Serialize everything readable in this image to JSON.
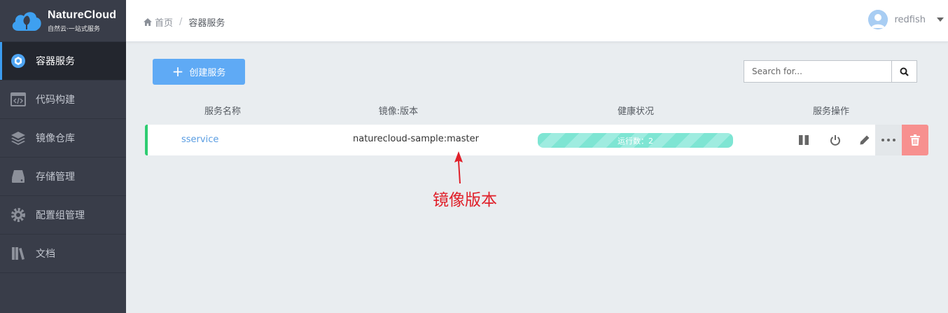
{
  "app": {
    "logo_title": "NatureCloud",
    "logo_subtitle": "自然云·一站式服务"
  },
  "sidebar": {
    "items": [
      {
        "label": "容器服务",
        "icon": "container-icon",
        "active": true
      },
      {
        "label": "代码构建",
        "icon": "code-icon"
      },
      {
        "label": "镜像仓库",
        "icon": "layers-icon"
      },
      {
        "label": "存储管理",
        "icon": "storage-icon"
      },
      {
        "label": "配置组管理",
        "icon": "gear-icon"
      },
      {
        "label": "文档",
        "icon": "books-icon"
      }
    ]
  },
  "header": {
    "breadcrumb": {
      "home": "首页",
      "separator": "/",
      "current": "容器服务"
    },
    "user": {
      "name": "redfish"
    }
  },
  "toolbar": {
    "create_label": "创建服务",
    "search_placeholder": "Search for..."
  },
  "table": {
    "headers": [
      "服务名称",
      "镜像:版本",
      "健康状况",
      "服务操作"
    ],
    "rows": [
      {
        "name": "sservice",
        "image": "naturecloud-sample:master",
        "health": "运行数：2",
        "status_color": "#2ecc71"
      }
    ]
  },
  "annotation": {
    "label": "镜像版本",
    "color": "#e0202a"
  },
  "colors": {
    "sidebar_bg": "#393d49",
    "accent": "#5faaf5",
    "health": "#7ee5d3",
    "delete": "#f7908f"
  }
}
